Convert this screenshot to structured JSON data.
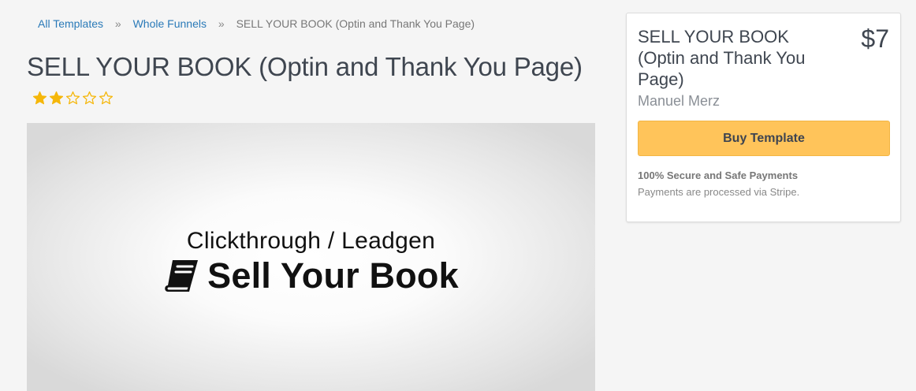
{
  "breadcrumb": {
    "items": [
      "All Templates",
      "Whole Funnels"
    ],
    "separator": "»",
    "current": "SELL YOUR BOOK (Optin and Thank You Page)"
  },
  "page": {
    "title": "SELL YOUR BOOK (Optin and Thank You Page)"
  },
  "rating": {
    "value": 2,
    "max": 5,
    "color": "#f5b70a"
  },
  "preview": {
    "subtitle": "Clickthrough / Leadgen",
    "title": "Sell Your Book",
    "icon": "book-icon"
  },
  "card": {
    "title": "SELL YOUR BOOK (Optin and Thank You Page)",
    "price": "$7",
    "author": "Manuel Merz",
    "buy_label": "Buy Template",
    "buy_color": "#ffc45a",
    "secure_title": "100% Secure and Safe Payments",
    "secure_subtitle": "Payments are processed via Stripe."
  }
}
